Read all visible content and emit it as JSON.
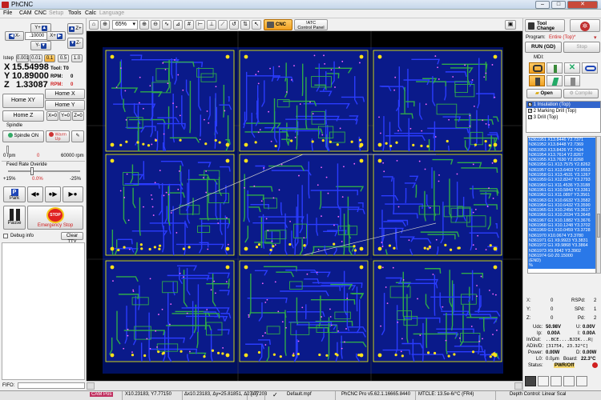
{
  "window": {
    "title": "PhCNC"
  },
  "menu": [
    {
      "label": "File",
      "disabled": false
    },
    {
      "label": "CAM",
      "disabled": false
    },
    {
      "label": "CNC",
      "disabled": false
    },
    {
      "label": "Setup",
      "disabled": true
    },
    {
      "label": "Tools",
      "disabled": false
    },
    {
      "label": "Calc",
      "disabled": false
    },
    {
      "label": "Language",
      "disabled": true
    }
  ],
  "jog": {
    "x_minus": "X-",
    "x_plus": "X+",
    "y_plus": "Y+",
    "y_minus": "Y-",
    "z_plus": "Z+",
    "z_minus": "Z-",
    "step_value": ".10000",
    "istep_label": "Istep",
    "steps": [
      "0.001",
      "0.01",
      "0.1",
      "0.5",
      "1.0"
    ],
    "selected_step": "0.1"
  },
  "position": {
    "x_label": "X",
    "x_value": "15.54998",
    "y_label": "Y",
    "y_value": "10.89000",
    "z_label": "Z",
    "z_value": "1.33087",
    "tool_label": "Tool: T0",
    "rpm_label": "RPM:",
    "rpm_value": "0",
    "rpm2_label": "RPM:",
    "rpm2_value": "0"
  },
  "buttons": {
    "home_xy": "Home XY",
    "home_x": "Home X",
    "home_y": "Home Y",
    "home_z": "Home Z",
    "x0": "X=0",
    "y0": "Y=0",
    "z0": "Z=0",
    "spindle": "Spindle",
    "spindle_on": "Spindle ON",
    "warm_up": "Warm Up",
    "park": "Park",
    "pause": "Pause",
    "estop": "Emergency Stop",
    "debug_info": "Debug info",
    "clear_tty": "Clear TTY"
  },
  "spindle": {
    "min": "0 rpm",
    "current": "0",
    "max": "60000 rpm"
  },
  "feed": {
    "label": "Feed Rate Overide",
    "min": "+15%",
    "current": "0.0%",
    "max": "-25%",
    "level": 0.33
  },
  "fifo_label": "FIFO:",
  "toolbar": {
    "zoom": "65%",
    "cnc_label": "CNC",
    "atc_label": "!ATC",
    "control_panel": "Control Panel"
  },
  "right": {
    "tool_change": "Tool Change",
    "program_label": "Program:",
    "program_value": "Entire (Top)*",
    "run": "RUN (GD)",
    "stop": "Stop",
    "mdi_label": "MDI:",
    "open": "Open",
    "compile": "Compile",
    "ops": [
      {
        "label": "1 Insulation (Top)",
        "checked": true,
        "selected": true
      },
      {
        "label": "2 Marking Drill (Top)",
        "checked": true,
        "selected": false
      },
      {
        "label": "3 Drill (Top)",
        "checked": true,
        "selected": false
      }
    ],
    "gcode": [
      "N361951 X13.8446 Y2.7371",
      "N361952 X13.8448 Y2.7369",
      "N361953 X13.8426 Y2.7434",
      "N361954 X13.7614 Y2.8267",
      "N361955 X13.7630 Y2.8268",
      "N361956 G1 X13.7575 Y2.8262",
      "N361957 G1 X13.6403 Y2.9553",
      "N361958 G1 X13.4531 Y3.1267",
      "N361959 G1 X12.8247 Y3.2793",
      "N361960 G1 X11.4536 Y3.3188",
      "N361961 G1 X10.5843 Y3.3361",
      "N361962 G1 X11.0897 Y3.3561",
      "N361963 G1 X10.6632 Y3.3582",
      "N361964 G1 X10.6432 Y3.3590",
      "N361965 G1 X10.2456 Y3.3617",
      "N361966 G1 X10.2034 Y3.3648",
      "N361967 G1 X10.1882 Y3.3676",
      "N361968 G1 X10.1248 Y3.3702",
      "N361969 G1 X10.0459 Y3.3728",
      "N361970 X10.0674 Y3.3780",
      "N361971 G1 X9.9923 Y3.3831",
      "N361972 G1 X9.9868 Y3.3864",
      "N361973 X9.9942 Y3.3902",
      "N361974 G0 Z0.15000",
      "(END)",
      "%"
    ],
    "readouts": {
      "x_label": "X:",
      "x_value": "0",
      "y_label": "Y:",
      "y_value": "0",
      "z_label": "Z:",
      "z_value": "0",
      "rsp_label": "RSPd:",
      "rsp_value": "2",
      "sph_label": "SPd:",
      "sph_value": "1",
      "pd_label": "Pd:",
      "pd_value": "2",
      "udc_label": "Udc:",
      "udc_value": "50.98V",
      "u_label": "U:",
      "u_value": "0.00V",
      "ip_label": "Ip:",
      "ip_value": "0.00A",
      "i_label": "I:",
      "i_value": "0.00A",
      "inout_label": "In/Out:",
      "inout_value": "..BCE....BJIK...R|",
      "adin_label": "ADIn/D:",
      "adin_value": "[31754, 23.32°C]",
      "power_label": "Power:",
      "power_value": "0.00W",
      "d_label": "D:",
      "d_value": "0.00W",
      "l0_label": "L0:",
      "l0_value": "0.0μm",
      "board_label": "Board:",
      "board_value": "22.3°C",
      "status_label": "Status:",
      "status_value": "PWR/Off"
    }
  },
  "statusbar": {
    "mode": "CAM Pos",
    "pos": "X10.23183, Y7.77150",
    "delta": "Δx10.23183, Δy=25.81851, Δ27.77203",
    "units": "[in]",
    "file": "Default.mpf",
    "version": "PhCNC Pro v5.62.1.16665.8440",
    "mtcle": "MTCLE: 13.5e-6/°C (FR4)",
    "depth": "Depth Control: Linear Scal"
  },
  "colors": {
    "canvas_bg": "#000000",
    "board_outline": "#ffff00",
    "trace_blue": "#2a3cff",
    "trace_green": "#2faa4a",
    "pad_yellow": "#ffe21a",
    "gcode_bg": "#2a78e8",
    "estop_red": "#e02020"
  }
}
